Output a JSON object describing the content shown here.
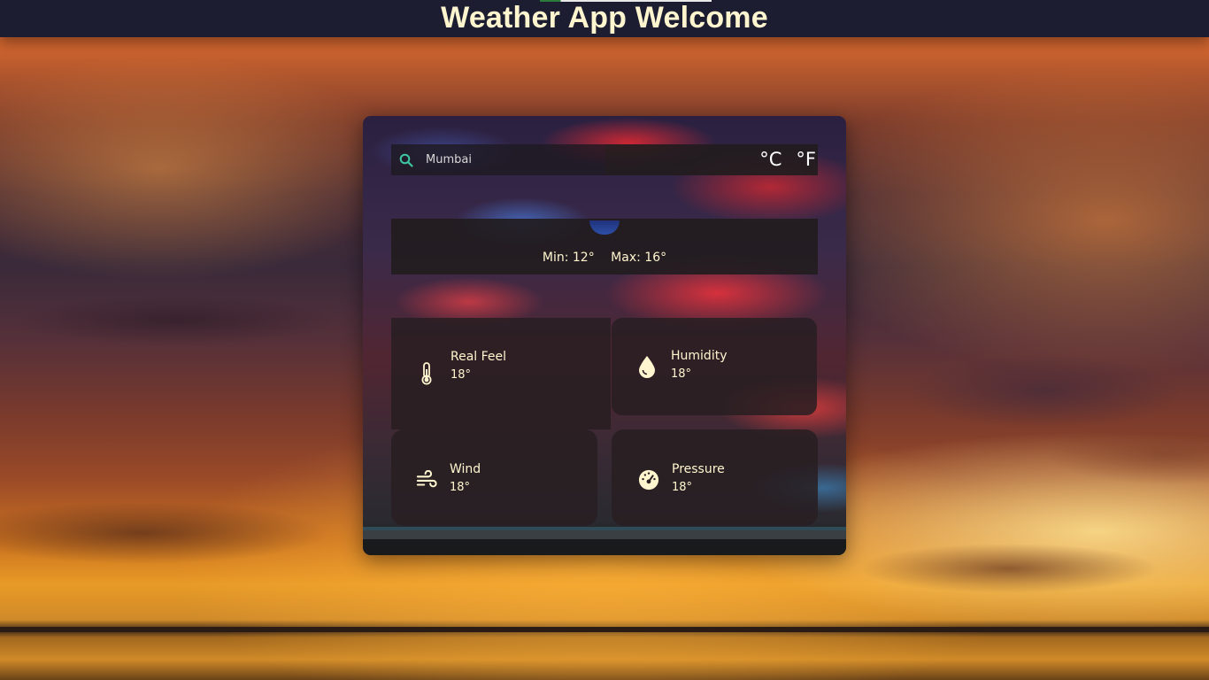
{
  "header": {
    "title": "Weather App Welcome"
  },
  "search": {
    "value": "",
    "placeholder": "Mumbai",
    "icon": "search-icon",
    "icon_color": "#3ec6a0"
  },
  "units": {
    "celsius_label": "°C",
    "fahrenheit_label": "°F"
  },
  "temperature": {
    "min_label": "Min: 12°",
    "max_label": "Max: 16°"
  },
  "details": {
    "real_feel": {
      "label": "Real Feel",
      "value": "18°",
      "icon": "thermometer-icon"
    },
    "humidity": {
      "label": "Humidity",
      "value": "18°",
      "icon": "water-drop-icon"
    },
    "wind": {
      "label": "Wind",
      "value": "18°",
      "icon": "wind-icon"
    },
    "pressure": {
      "label": "Pressure",
      "value": "18°",
      "icon": "gauge-icon"
    }
  },
  "colors": {
    "header_bg": "#1d1d32",
    "title_text": "#fff6cf",
    "panel_text": "#fff6cf"
  }
}
